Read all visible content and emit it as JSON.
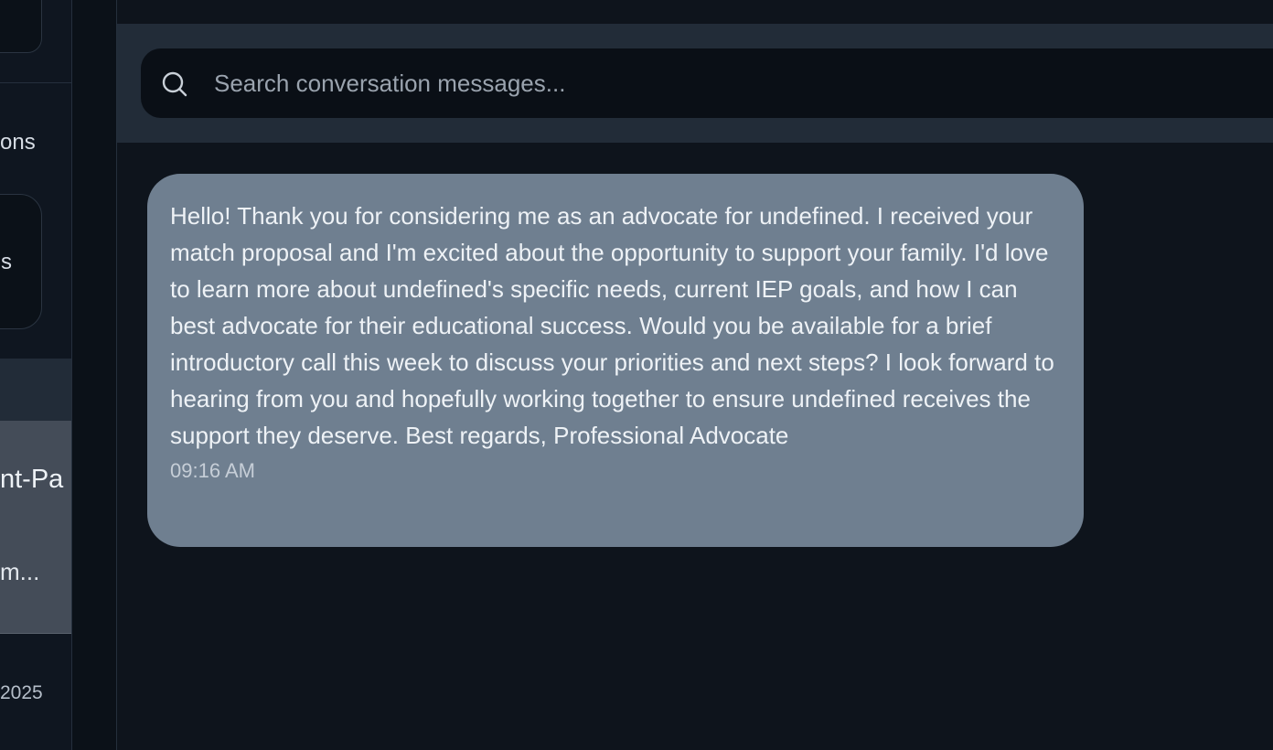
{
  "sidebar": {
    "partial_label_1": "ons",
    "partial_label_2": "s",
    "active_conversation": {
      "title_fragment": "nt-Pa",
      "preview_fragment": "m..."
    },
    "date_fragment": "2025"
  },
  "search": {
    "placeholder": "Search conversation messages...",
    "value": "",
    "icon": "search-icon"
  },
  "messages": [
    {
      "text": "Hello! Thank you for considering me as an advocate for undefined. I received your match proposal and I'm excited about the opportunity to support your family. I'd love to learn more about undefined's specific needs, current IEP goals, and how I can best advocate for their educational success. Would you be available for a brief introductory call this week to discuss your priorities and next steps? I look forward to hearing from you and hopefully working together to ensure undefined receives the support they deserve. Best regards, Professional Advocate",
      "time": "09:16 AM"
    }
  ],
  "colors": {
    "background": "#0e141c",
    "search_bar_band": "#222c38",
    "search_box": "#0a0f16",
    "message_bubble": "#6f7f90",
    "active_item": "#444c58"
  }
}
